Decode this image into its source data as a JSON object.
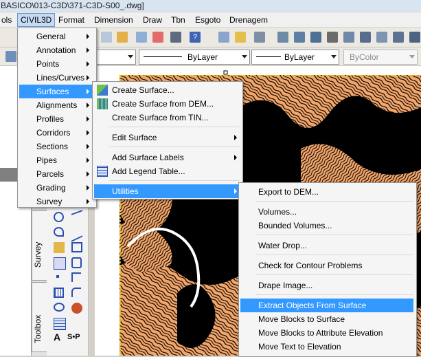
{
  "window": {
    "title": "BASICO\\013-C3D\\371-C3D-S00_.dwg]"
  },
  "menubar": [
    {
      "label": "ols"
    },
    {
      "label": "CIVIL3D",
      "active": true
    },
    {
      "label": "Format"
    },
    {
      "label": "Dimension"
    },
    {
      "label": "Draw"
    },
    {
      "label": "Tbn"
    },
    {
      "label": "Esgoto"
    },
    {
      "label": "Drenagem"
    }
  ],
  "properties_bar": {
    "linetype": "ByLayer",
    "lineweight": "ByLayer",
    "color": "ByColor"
  },
  "civil3d_menu": {
    "items": [
      {
        "label": "General",
        "submenu": true
      },
      {
        "label": "Annotation",
        "submenu": true
      },
      {
        "label": "Points",
        "submenu": true
      },
      {
        "label": "Lines/Curves",
        "submenu": true
      },
      {
        "label": "Surfaces",
        "submenu": true,
        "highlighted": true
      },
      {
        "label": "Alignments",
        "submenu": true
      },
      {
        "label": "Profiles",
        "submenu": true
      },
      {
        "label": "Corridors",
        "submenu": true
      },
      {
        "label": "Sections",
        "submenu": true
      },
      {
        "label": "Pipes",
        "submenu": true
      },
      {
        "label": "Parcels",
        "submenu": true
      },
      {
        "label": "Grading",
        "submenu": true
      },
      {
        "label": "Survey",
        "submenu": true
      }
    ]
  },
  "surfaces_menu": {
    "items": [
      {
        "label": "Create Surface...",
        "icon": "create-surface-icon"
      },
      {
        "label": "Create Surface from DEM...",
        "icon": "dem-surface-icon"
      },
      {
        "label": "Create Surface from TIN..."
      },
      {
        "label": "Edit Surface",
        "submenu": true
      },
      {
        "label": "Add Surface Labels",
        "submenu": true
      },
      {
        "label": "Add Legend Table...",
        "icon": "legend-table-icon"
      },
      {
        "label": "Utilities",
        "submenu": true,
        "highlighted": true
      }
    ]
  },
  "utilities_menu": {
    "items": [
      {
        "label": "Export to DEM..."
      },
      {
        "label": "Volumes..."
      },
      {
        "label": "Bounded Volumes..."
      },
      {
        "label": "Water Drop..."
      },
      {
        "label": "Check for Contour Problems"
      },
      {
        "label": "Drape Image..."
      },
      {
        "label": "Extract Objects From Surface",
        "highlighted": true
      },
      {
        "label": "Move Blocks to Surface"
      },
      {
        "label": "Move Blocks to Attribute Elevation"
      },
      {
        "label": "Move Text to Elevation"
      }
    ]
  },
  "palette_tabs": {
    "survey": "Survey",
    "toolbox": "Toolbox"
  },
  "palette_text": {
    "a": "A",
    "sp": "S•P"
  },
  "colors": {
    "menu_highlight": "#3399ff",
    "contour_fill": "#f4a66a",
    "contour_background": "#000000",
    "selection_dash": "#e8d800"
  }
}
